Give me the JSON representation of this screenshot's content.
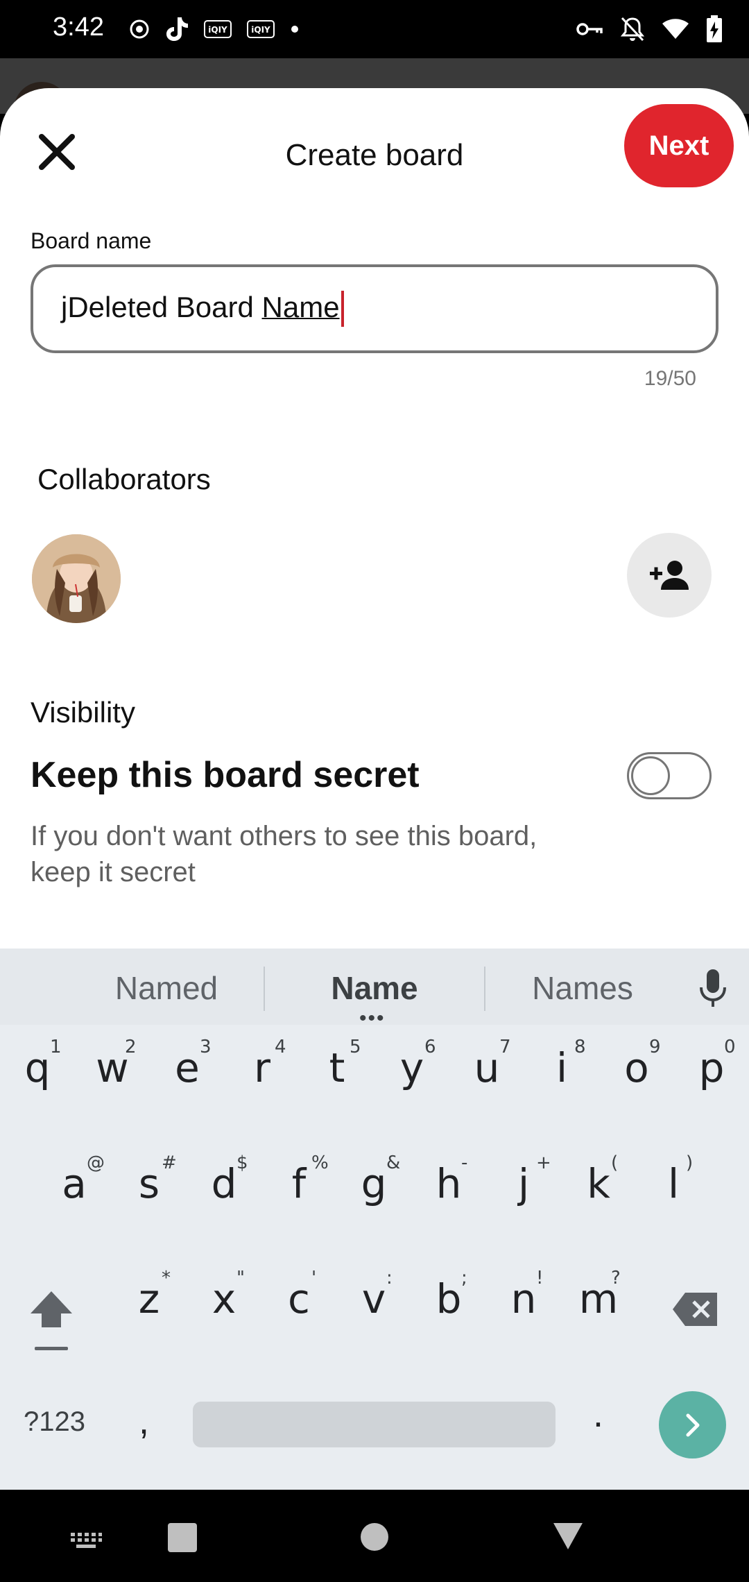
{
  "status_bar": {
    "time": "3:42",
    "left_icons": [
      "record-icon",
      "tiktok-icon",
      "iqiyi-icon",
      "iqiyi-icon",
      "dot-icon"
    ],
    "right_icons": [
      "vpn-key-icon",
      "bell-off-icon",
      "wifi-icon",
      "battery-charging-icon"
    ]
  },
  "sheet": {
    "title": "Create board",
    "next_label": "Next",
    "close_icon": "close-icon"
  },
  "board_name": {
    "label": "Board name",
    "value_prefix": "jDeleted Board ",
    "value_composing": "Name",
    "counter": "19/50"
  },
  "collaborators": {
    "label": "Collaborators",
    "add_icon": "add-person-icon"
  },
  "visibility": {
    "label": "Visibility",
    "title": "Keep this board secret",
    "description": "If you don't want others to see this board, keep it secret",
    "toggle_on": false
  },
  "keyboard": {
    "suggestions": [
      "Named",
      "Name",
      "Names"
    ],
    "row1": [
      {
        "k": "q",
        "h": "1"
      },
      {
        "k": "w",
        "h": "2"
      },
      {
        "k": "e",
        "h": "3"
      },
      {
        "k": "r",
        "h": "4"
      },
      {
        "k": "t",
        "h": "5"
      },
      {
        "k": "y",
        "h": "6"
      },
      {
        "k": "u",
        "h": "7"
      },
      {
        "k": "i",
        "h": "8"
      },
      {
        "k": "o",
        "h": "9"
      },
      {
        "k": "p",
        "h": "0"
      }
    ],
    "row2": [
      {
        "k": "a",
        "h": "@"
      },
      {
        "k": "s",
        "h": "#"
      },
      {
        "k": "d",
        "h": "$"
      },
      {
        "k": "f",
        "h": "%"
      },
      {
        "k": "g",
        "h": "&"
      },
      {
        "k": "h",
        "h": "-"
      },
      {
        "k": "j",
        "h": "+"
      },
      {
        "k": "k",
        "h": "("
      },
      {
        "k": "l",
        "h": ")"
      }
    ],
    "row3": [
      {
        "k": "z",
        "h": "*"
      },
      {
        "k": "x",
        "h": "\""
      },
      {
        "k": "c",
        "h": "'"
      },
      {
        "k": "v",
        "h": ":"
      },
      {
        "k": "b",
        "h": ";"
      },
      {
        "k": "n",
        "h": "!"
      },
      {
        "k": "m",
        "h": "?"
      }
    ],
    "symbols_label": "?123",
    "comma": ",",
    "period": "."
  },
  "colors": {
    "accent": "#e0252d",
    "go_key": "#5bb2a4"
  }
}
